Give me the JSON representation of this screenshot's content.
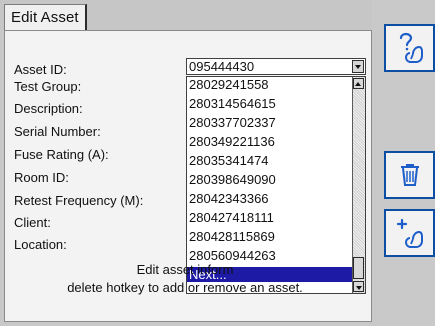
{
  "tab": {
    "label": "Edit Asset"
  },
  "form": {
    "fields": [
      "Asset ID:",
      "Test Group:",
      "Description:",
      "Serial Number:",
      "Fuse Rating (A):",
      "Room ID:",
      "Retest Frequency (M):",
      "Client:",
      "Location:"
    ],
    "asset_id_value": "095444430"
  },
  "dropdown": {
    "items": [
      "28029241558",
      "280314564615",
      "280337702337",
      "280349221136",
      "28035341474",
      "280398649090",
      "28042343366",
      "280427418111",
      "280428115869",
      "280560944263",
      "Next..."
    ],
    "selected_item": "Next..."
  },
  "help": {
    "line1": "Edit asset inform",
    "line2": "delete hotkey to add or remove an asset."
  },
  "toolbar": {
    "help_icon": "help-icon",
    "delete_icon": "trash-icon",
    "add_icon": "add-asset-icon"
  },
  "colors": {
    "selection": "#1d1ba6",
    "button_border": "#0b4ea3"
  }
}
